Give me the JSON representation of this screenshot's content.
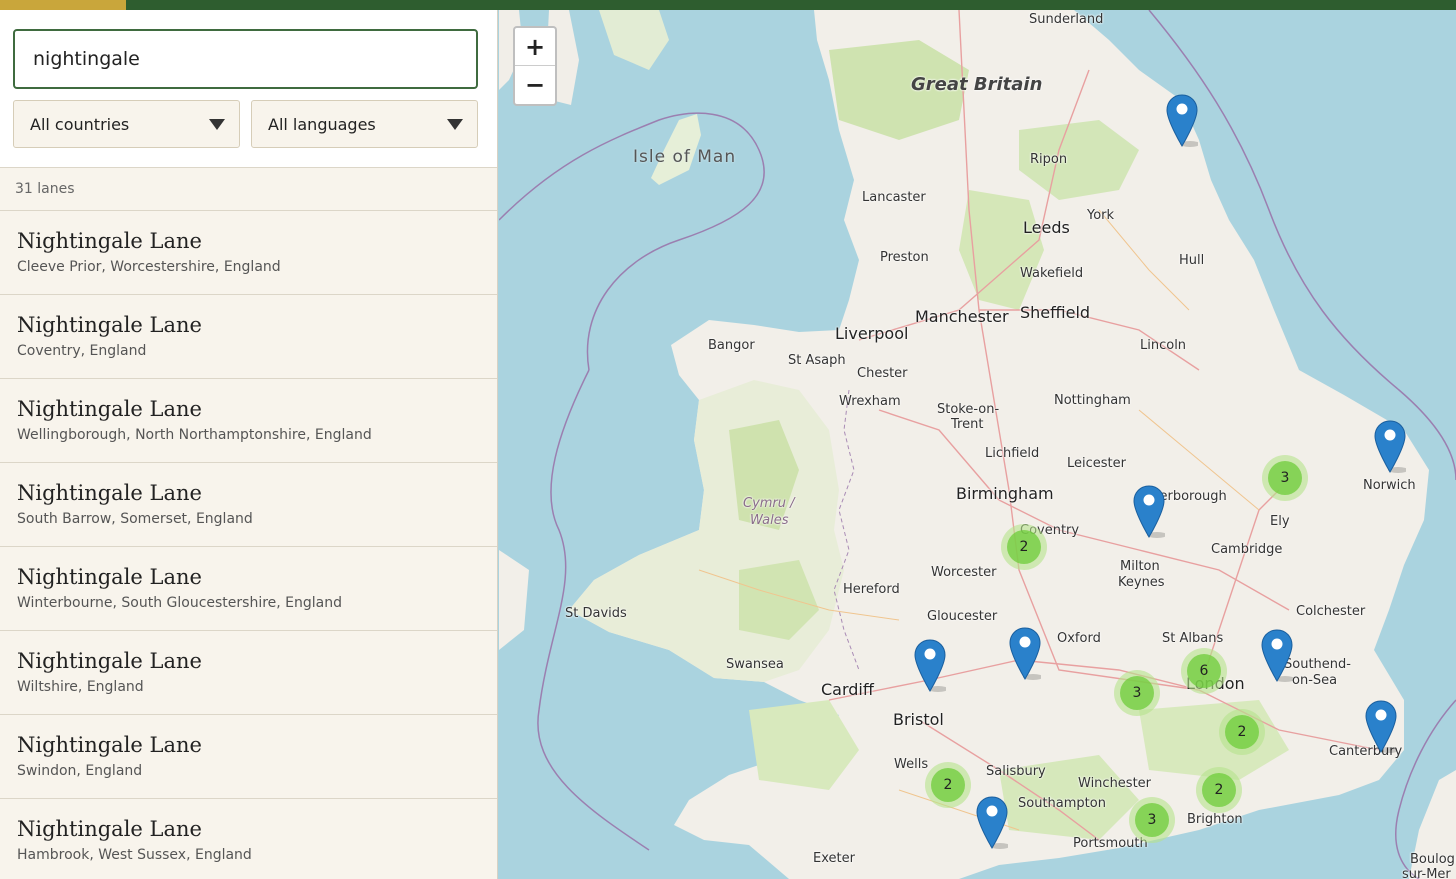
{
  "colors": {
    "brand": "#2e5d2f",
    "accent": "#c9a63b",
    "cluster": "#6ecc39",
    "pin": "#2a81cb"
  },
  "search": {
    "value": "nightingale"
  },
  "filters": {
    "country": "All countries",
    "language": "All languages"
  },
  "results_count": "31 lanes",
  "results": [
    {
      "name": "Nightingale Lane",
      "place": "Cleeve Prior, Worcestershire, England"
    },
    {
      "name": "Nightingale Lane",
      "place": "Coventry, England"
    },
    {
      "name": "Nightingale Lane",
      "place": "Wellingborough, North Northamptonshire, England"
    },
    {
      "name": "Nightingale Lane",
      "place": "South Barrow, Somerset, England"
    },
    {
      "name": "Nightingale Lane",
      "place": "Winterbourne, South Gloucestershire, England"
    },
    {
      "name": "Nightingale Lane",
      "place": "Wiltshire, England"
    },
    {
      "name": "Nightingale Lane",
      "place": "Swindon, England"
    },
    {
      "name": "Nightingale Lane",
      "place": "Hambrook, West Sussex, England"
    }
  ],
  "map": {
    "zoom_in": "+",
    "zoom_out": "−",
    "labels": {
      "great_britain": "Great Britain",
      "isle_of_man": "Isle of Man",
      "cymru": "Cymru /",
      "wales": "Wales",
      "sunderland": "Sunderland",
      "ripon": "Ripon",
      "lancaster": "Lancaster",
      "york": "York",
      "leeds": "Leeds",
      "preston": "Preston",
      "hull": "Hull",
      "wakefield": "Wakefield",
      "manchester": "Manchester",
      "sheffield": "Sheffield",
      "liverpool": "Liverpool",
      "bangor": "Bangor",
      "st_asaph": "St Asaph",
      "chester": "Chester",
      "lincoln": "Lincoln",
      "wrexham": "Wrexham",
      "nottingham": "Nottingham",
      "stoke_1": "Stoke-on-",
      "stoke_2": "Trent",
      "lichfield": "Lichfield",
      "leicester": "Leicester",
      "norwich": "Norwich",
      "birmingham": "Birmingham",
      "peterborough": "Peterborough",
      "ely": "Ely",
      "coventry": "Coventry",
      "cambridge": "Cambridge",
      "worcester": "Worcester",
      "milton_1": "Milton",
      "milton_2": "Keynes",
      "hereford": "Hereford",
      "colchester": "Colchester",
      "st_davids": "St Davids",
      "gloucester": "Gloucester",
      "oxford": "Oxford",
      "st_albans": "St Albans",
      "swansea": "Swansea",
      "southend_1": "Southend-",
      "southend_2": "on-Sea",
      "london": "London",
      "cardiff": "Cardiff",
      "bristol": "Bristol",
      "canterbury": "Canterbury",
      "wells": "Wells",
      "salisbury": "Salisbury",
      "winchester": "Winchester",
      "southampton": "Southampton",
      "brighton": "Brighton",
      "portsmouth": "Portsmouth",
      "exeter": "Exeter",
      "boulogne_1": "Boulogne-",
      "boulogne_2": "sur-Mer"
    },
    "clusters": [
      "3",
      "2",
      "6",
      "3",
      "2",
      "2",
      "2",
      "3"
    ]
  }
}
